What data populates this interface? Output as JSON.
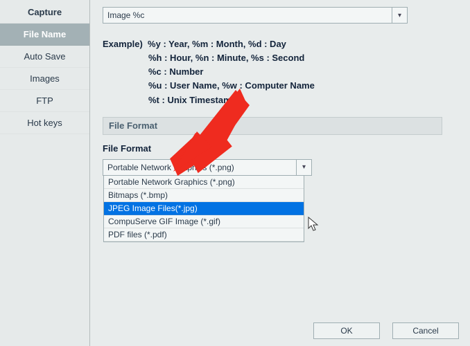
{
  "sidebar": {
    "items": [
      {
        "label": "Capture"
      },
      {
        "label": "File Name"
      },
      {
        "label": "Auto Save"
      },
      {
        "label": "Images"
      },
      {
        "label": "FTP"
      },
      {
        "label": "Hot keys"
      }
    ],
    "selected_index": 1
  },
  "filename_combo": {
    "value": "Image %c"
  },
  "example": {
    "label": "Example)",
    "line1": "%y : Year, %m : Month, %d : Day",
    "line2": "%h : Hour, %n : Minute, %s : Second",
    "line3": "%c : Number",
    "line4": "%u : User Name, %w : Computer Name",
    "line5": "%t : Unix Timestamp"
  },
  "section_title": "File Format",
  "format_label": "File Format",
  "format_combo": {
    "selected": "Portable Network Graphics (*.png)",
    "options": [
      "Portable Network Graphics (*.png)",
      "Bitmaps (*.bmp)",
      "JPEG Image Files(*.jpg)",
      "CompuServe GIF Image (*.gif)",
      "PDF files (*.pdf)"
    ],
    "highlight_index": 2
  },
  "buttons": {
    "ok": "OK",
    "cancel": "Cancel"
  },
  "annotation_arrow_color": "#ef2b1f"
}
